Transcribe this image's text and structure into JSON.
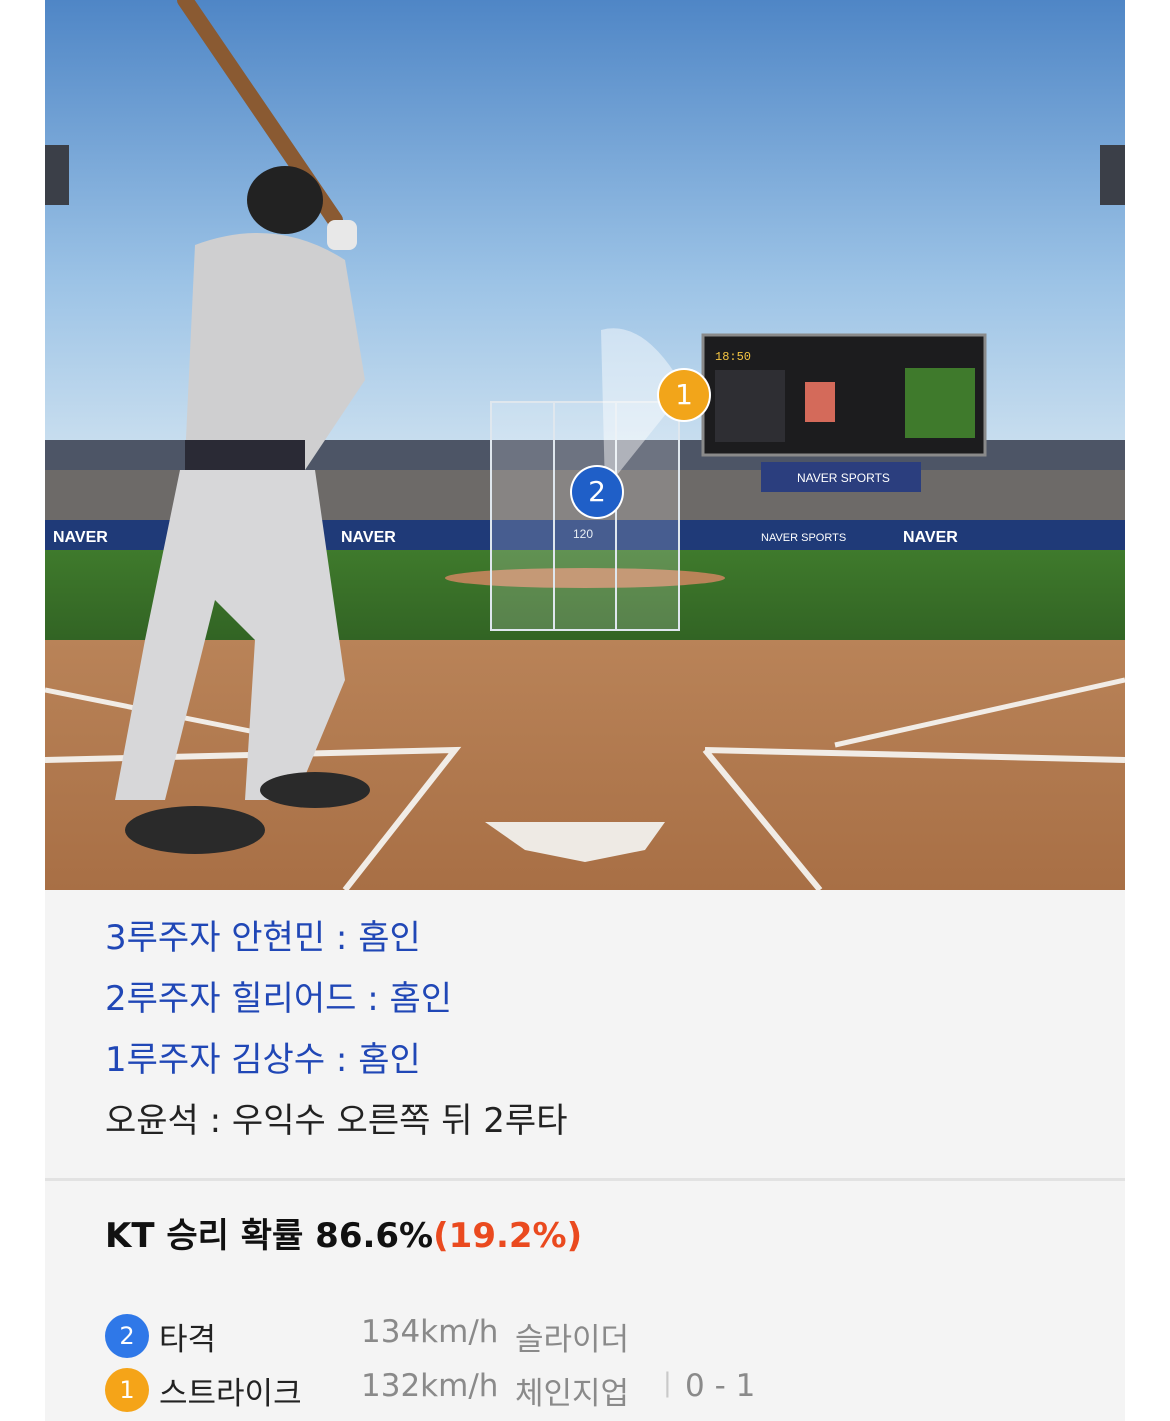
{
  "scene": {
    "stadium_ad": "NAVER",
    "stadium_ad_sports": "NAVER SPORTS",
    "strike_zone_speed": "120",
    "scoreboard_time": "18:50",
    "markers": [
      {
        "number": "1",
        "color": "#f2a51a"
      },
      {
        "number": "2",
        "color": "#1f5fc8"
      }
    ]
  },
  "plays": [
    "3루주자 안현민 : 홈인",
    "2루주자 힐리어드 : 홈인",
    "1루주자 김상수 : 홈인",
    "오윤석 : 우익수 오른쪽 뒤 2루타"
  ],
  "win_probability": {
    "label": "KT 승리 확률 86.6%",
    "delta": "(19.2%)"
  },
  "pitches": [
    {
      "number": "2",
      "type": "타격",
      "speed": "134km/h",
      "kind": "슬라이더",
      "count": ""
    },
    {
      "number": "1",
      "type": "스트라이크",
      "speed": "132km/h",
      "kind": "체인지업",
      "count": "0 - 1"
    }
  ],
  "colors": {
    "runner_text": "#2047b6",
    "delta_text": "#ea4a1f",
    "marker_blue": "#2f78e8",
    "marker_orange": "#f5a418"
  }
}
